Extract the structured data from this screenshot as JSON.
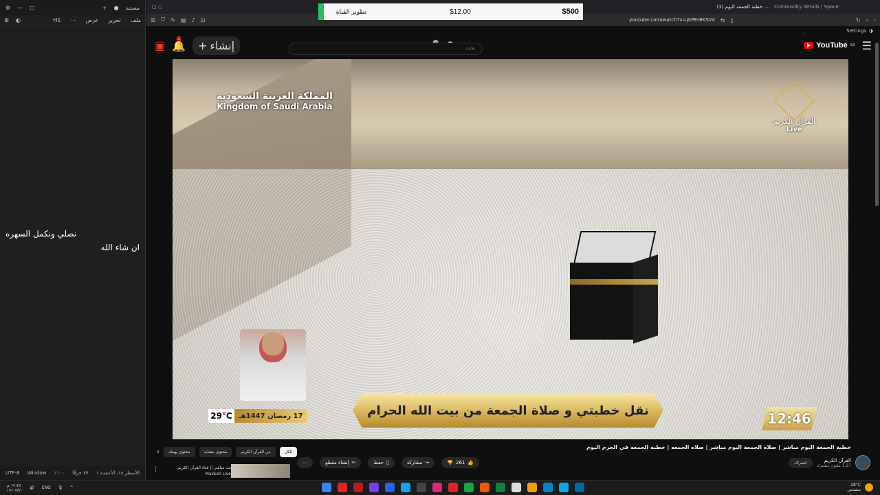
{
  "notepad": {
    "tab_label": "مستند",
    "menu": [
      "ملف",
      "تحرير",
      "عرض"
    ],
    "heading_btn": "H1",
    "text_line1": "نصلي ونكمل السهره",
    "text_line2": "ان شاء الله",
    "status": {
      "position": "الأسطر ١٨، الأعمدة ١",
      "chars": "٧٧ حرفًا",
      "zoom": "١٠٠٪",
      "lineending": "Window",
      "encoding": "UTF-8"
    }
  },
  "popup": {
    "label": "تطوير القناة",
    "middle": "$12.00",
    "big": "$500"
  },
  "browser": {
    "tabs": [
      "خطبة الجمعة اليوم ...",
      "Commodity details | Space"
    ],
    "url": "youtube.com/watch?v=ptPEr8KSV4",
    "settings_label": "Settings",
    "tab_count": "(1)"
  },
  "youtube": {
    "logo": "YouTube",
    "logo_region": "SA",
    "search_placeholder": "بحث",
    "create_label": "إنشاء",
    "notif_count": "1"
  },
  "video": {
    "ksa_ar": "المملكة العربية السعودية",
    "ksa_en": "Kingdom of Saudi Arabia",
    "channel_logo_ar": "القرآن الكريم",
    "live": "Live",
    "lower_third": "نقل خطبتي و صلاة الجمعة من بيت الله الحرام",
    "clock": "12:46",
    "date": "17 رمضان 1447هـ",
    "temp": "29°C"
  },
  "chips": [
    "الكل",
    "من القرآن الكريم",
    "محتوى مشابه",
    "محتوى يهمك"
  ],
  "title": "خطبة الجمعة اليوم مباشر | صلاة الجمعة اليوم مباشر | صلاه الجمعه | خطبه الجمعه في الحرم اليوم",
  "actions": {
    "like_count": "261",
    "share": "مشاركة",
    "save": "حفظ",
    "clip": "إنشاء مقطع"
  },
  "channel": {
    "name": "القرآن الكريم",
    "subs": "1.27 مليون مشترك",
    "join": "اشتراك"
  },
  "side_video": {
    "title": "بث مباشر || قناة القرآن الكريم Makkah Live"
  },
  "taskbar": {
    "lang": "ENG",
    "time": "١٢:٤٧ م",
    "date": "١٧/٠٣/٢٠",
    "weather": "28°C",
    "weather_desc": "مشمس"
  }
}
